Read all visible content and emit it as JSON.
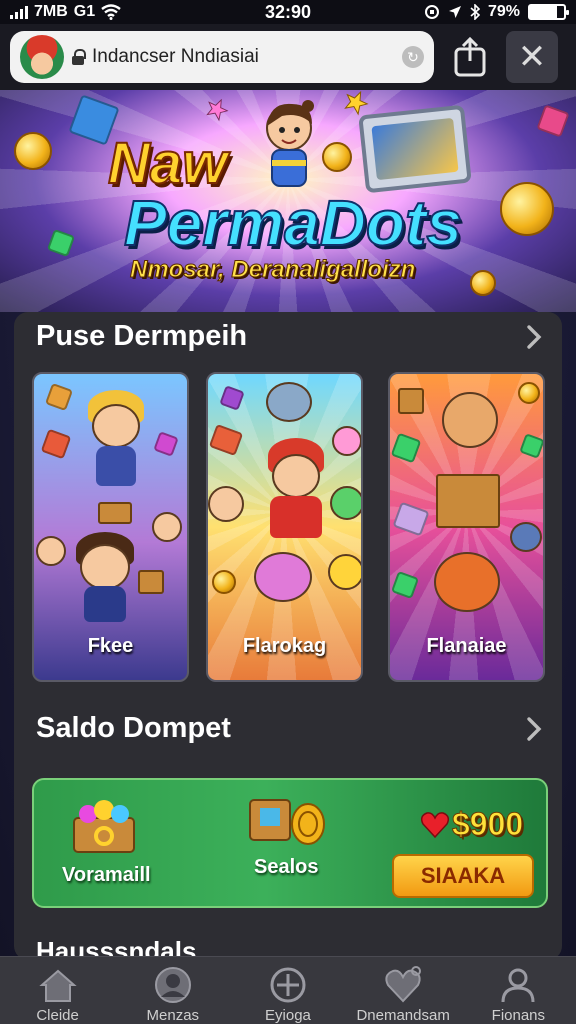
{
  "status_bar": {
    "carrier": "7MB",
    "network": "G1",
    "time": "32:90",
    "battery_text": "79%",
    "battery_level": 0.79
  },
  "browser": {
    "url_text": "Indancser Nndiasiai",
    "close_label": "✕"
  },
  "hero": {
    "title_line1": "Naw",
    "title_line2": "PermaDots",
    "subtitle": "Nmosar, Deranaligalloizn"
  },
  "games_section": {
    "title": "Puse Dermpeih",
    "cards": [
      {
        "label": "Fkee"
      },
      {
        "label": "Flarokag"
      },
      {
        "label": "Flanaiae"
      }
    ]
  },
  "wallet_section": {
    "title": "Saldo Dompet",
    "items": [
      {
        "label": "Voramaill"
      },
      {
        "label": "Sealos"
      }
    ],
    "amount": "$900",
    "action_label": "SIAAKA",
    "next_section_partial": "Hausssndals"
  },
  "bottom_nav": {
    "items": [
      {
        "label": "Cleide",
        "icon": "home-icon"
      },
      {
        "label": "Menzas",
        "icon": "user-icon"
      },
      {
        "label": "Eyioga",
        "icon": "compass-icon"
      },
      {
        "label": "Dnemandsam",
        "icon": "heart-icon"
      },
      {
        "label": "Fionans",
        "icon": "profile-icon"
      }
    ]
  },
  "colors": {
    "panel_bg": "#2d2d33",
    "wallet_green": "#3cb05a",
    "accent_yellow": "#ffd44a"
  }
}
